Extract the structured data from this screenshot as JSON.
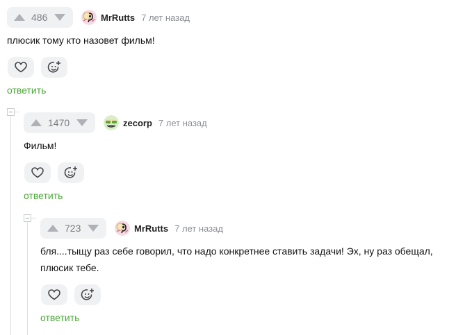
{
  "reply_label": "ответить",
  "colors": {
    "accent": "#4ca83a",
    "muted": "#8a8d92",
    "pill": "#f0f1f3"
  },
  "comments": [
    {
      "votes": "486",
      "author": "MrRutts",
      "time": "7 лет назад",
      "lines": [
        "плюсик тому кто назовет фильм!"
      ],
      "avatar": "mrrutts-avatar"
    },
    {
      "votes": "1470",
      "author": "zecorp",
      "time": "7 лет назад",
      "lines": [
        "Фильм!"
      ],
      "avatar": "zecorp-avatar"
    },
    {
      "votes": "723",
      "author": "MrRutts",
      "time": "7 лет назад",
      "lines": [
        "бля....тыщу раз себе говорил, что надо конкретнее ставить задачи! Эх, ну раз обещал,",
        "плюсик тебе."
      ],
      "avatar": "mrrutts-avatar"
    }
  ],
  "icons": {
    "upvote": "triangle-up-icon",
    "downvote": "triangle-down-icon",
    "like": "heart-icon",
    "react": "smiley-plus-icon",
    "collapse": "collapse-box-icon"
  }
}
